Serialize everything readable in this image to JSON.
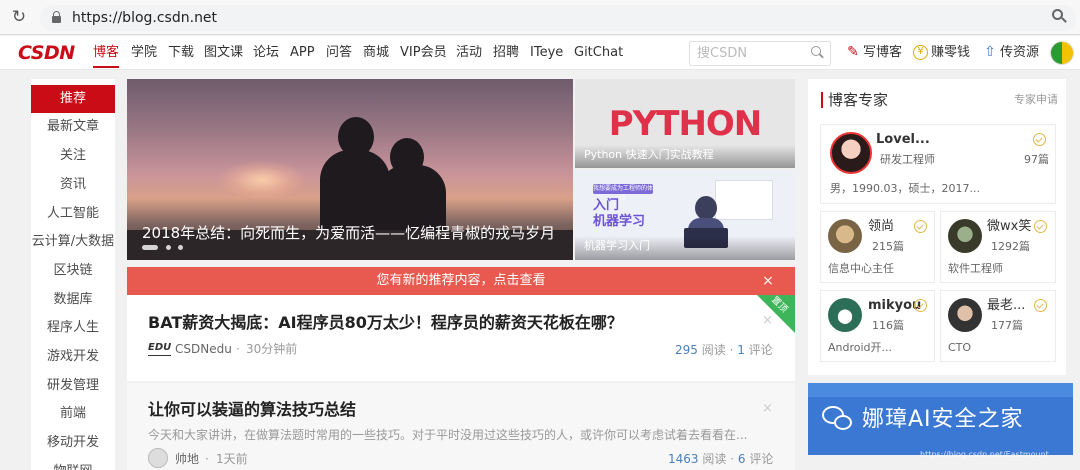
{
  "browser": {
    "url": "https://blog.csdn.net"
  },
  "nav": {
    "logo": "CSDN",
    "items": [
      "博客",
      "学院",
      "下载",
      "图文课",
      "论坛",
      "APP",
      "问答",
      "商城",
      "VIP会员",
      "活动",
      "招聘",
      "ITeye",
      "GitChat"
    ],
    "active_index": 0,
    "search_placeholder": "搜CSDN",
    "write_blog": "写博客",
    "earn": "赚零钱",
    "upload": "传资源"
  },
  "sidebar": {
    "items": [
      "推荐",
      "最新文章",
      "关注",
      "资讯",
      "人工智能",
      "云计算/大数据",
      "区块链",
      "数据库",
      "程序人生",
      "游戏开发",
      "研发管理",
      "前端",
      "移动开发",
      "物联网"
    ],
    "active_index": 0
  },
  "hero": {
    "caption": "2018年总结：向死而生，为爱而活——忆编程青椒的戎马岁月",
    "tile1_title": "PYTHON",
    "tile1_caption": "Python 快速入门实战教程",
    "tile2_badge": "我想要成为工程师的体验",
    "tile2_title_line1": "入门",
    "tile2_title_line2": "机器学习",
    "tile2_caption": "机器学习入门"
  },
  "notice": {
    "text": "您有新的推荐内容，点击查看",
    "close": "×"
  },
  "articles": [
    {
      "title": "BAT薪资大揭底：AI程序员80万太少！程序员的薪资天花板在哪？",
      "author": "CSDNedu",
      "author_logo": "EDU",
      "time": "30分钟前",
      "reads": "295",
      "reads_label": "阅读",
      "comments": "1",
      "comments_label": "评论",
      "badge": "置顶",
      "close": "×"
    },
    {
      "title": "让你可以装逼的算法技巧总结",
      "desc": "今天和大家讲讲，在做算法题时常用的一些技巧。对于平时没用过这些技巧的人，或许你可以考虑试着去看看在...",
      "author": "帅地",
      "time": "1天前",
      "reads": "1463",
      "reads_label": "阅读",
      "comments": "6",
      "comments_label": "评论",
      "close": "×"
    }
  ],
  "experts": {
    "title": "博客专家",
    "apply": "专家申请",
    "featured": {
      "name": "Lovel...",
      "role": "研发工程师",
      "count": "97篇",
      "info": "男，1990.03，硕士，2017..."
    },
    "list": [
      {
        "name": "领尚",
        "count": "215篇",
        "role": "信息中心主任"
      },
      {
        "name": "微wx笑",
        "count": "1292篇",
        "role": "软件工程师"
      },
      {
        "name": "mikyou",
        "count": "116篇",
        "role": "Android开..."
      },
      {
        "name": "最老...",
        "count": "177篇",
        "role": "CTO"
      }
    ]
  },
  "banner": {
    "text": "娜璋AI安全之家",
    "watermark": "https://blog.csdn.net/Eastmount"
  },
  "colors": {
    "brand": "#ca0c16",
    "notice": "#e85a4f",
    "link": "#4c7fb8",
    "badge": "#3fb55a"
  }
}
